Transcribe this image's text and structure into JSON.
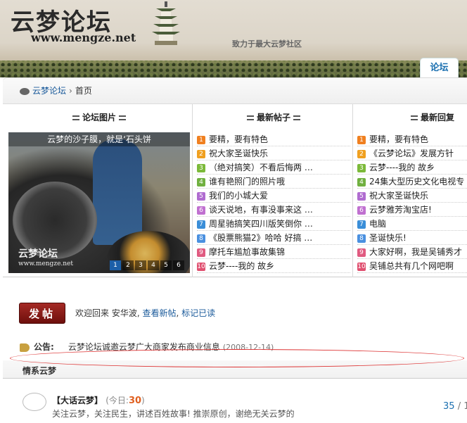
{
  "header": {
    "logo_text": "云梦论坛",
    "logo_url": "www.mengze.net",
    "slogan": "致力于最大云梦社区",
    "tab_forum": "论坛"
  },
  "breadcrumb": {
    "home": "云梦论坛",
    "separator": "›",
    "current": "首页"
  },
  "portal": {
    "col1_title": "论坛图片",
    "col2_title": "最新帖子",
    "col3_title": "最新回复",
    "photo": {
      "caption": "云梦的沙子膜，就是‘石头饼",
      "watermark": "云梦论坛",
      "watermark_url": "www.mengze.net",
      "pager": [
        "1",
        "2",
        "3",
        "4",
        "5",
        "6"
      ],
      "active_page": "1"
    },
    "latest_posts": [
      "要精，要有特色",
      "祝大家圣诞快乐",
      "（绝对搞笑）不看后悔两 …",
      "谁有艳照门的照片哦",
      "我们的小城大爱",
      "谈天说地，有事没事来这 …",
      "周星驰搞笑四川版笑倒你 …",
      "《股票熊猫2》哈哈 好搞 …",
      "摩托车尴尬事故集锦",
      "云梦----我的 故乡"
    ],
    "latest_replies": [
      "要精，要有特色",
      "《云梦论坛》发展方针",
      "云梦----我的 故乡",
      "24集大型历史文化电视专",
      "祝大家圣诞快乐",
      "云梦雅芳淘宝店!",
      "电脑",
      "圣诞快乐!",
      "大家好啊，我是吴铺秀才",
      "吴铺总共有几个网吧啊"
    ]
  },
  "actions": {
    "post_button": "发帖",
    "welcome_prefix": "欢迎回来 安华波,",
    "view_new": "查看新帖",
    "mark_read": "标记已读"
  },
  "notice": {
    "label": "公告:",
    "text": "云梦论坛诚邀云梦广大商家发布商业信息",
    "date": "(2008-12-14)"
  },
  "category": {
    "title": "情系云梦"
  },
  "forum": {
    "name": "【大话云梦】",
    "today_label": "(今日:",
    "today_count": "30",
    "today_close": ")",
    "description": "关注云梦，关注民生，讲述百姓故事! 推崇原创，谢绝无关云梦的",
    "topics": "35",
    "slash": "/ 1"
  }
}
